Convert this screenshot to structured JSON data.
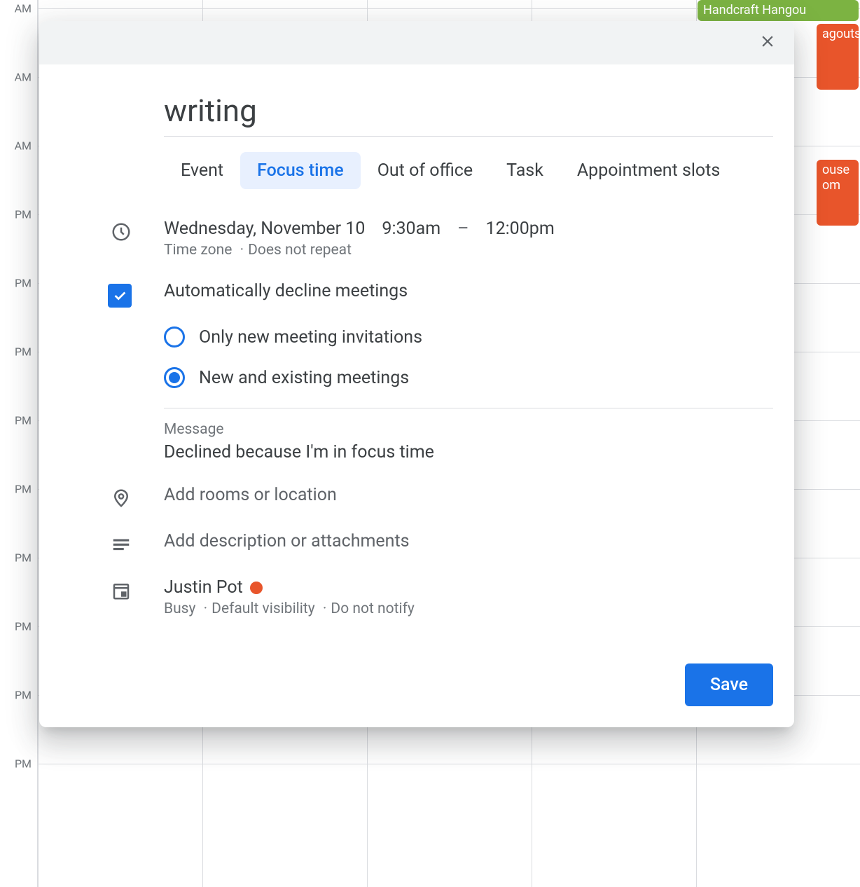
{
  "background": {
    "time_labels": [
      "AM",
      "AM",
      "AM",
      "PM",
      "PM",
      "PM",
      "PM",
      "PM",
      "PM",
      "PM",
      "PM",
      "PM"
    ],
    "events": [
      {
        "label": "Handcraft Hangou",
        "color": "green"
      },
      {
        "label": "agouts",
        "color": "orange"
      },
      {
        "label_line1": "ouse",
        "label_line2": "om",
        "color": "orange"
      }
    ]
  },
  "modal": {
    "title": "writing",
    "tabs": [
      "Event",
      "Focus time",
      "Out of office",
      "Task",
      "Appointment slots"
    ],
    "active_tab": "Focus time",
    "time": {
      "date": "Wednesday, November 10",
      "start": "9:30am",
      "dash": "–",
      "end": "12:00pm",
      "tz_label": "Time zone",
      "repeat_label": "Does not repeat"
    },
    "auto_decline": {
      "checked": true,
      "label": "Automatically decline meetings",
      "options": [
        {
          "label": "Only new meeting invitations",
          "selected": false
        },
        {
          "label": "New and existing meetings",
          "selected": true
        }
      ]
    },
    "message": {
      "label": "Message",
      "value": "Declined because I'm in focus time"
    },
    "location_placeholder": "Add rooms or location",
    "description_placeholder": "Add description or attachments",
    "calendar": {
      "owner": "Justin Pot",
      "status": "Busy",
      "visibility": "Default visibility",
      "notify": "Do not notify"
    },
    "save_label": "Save"
  }
}
